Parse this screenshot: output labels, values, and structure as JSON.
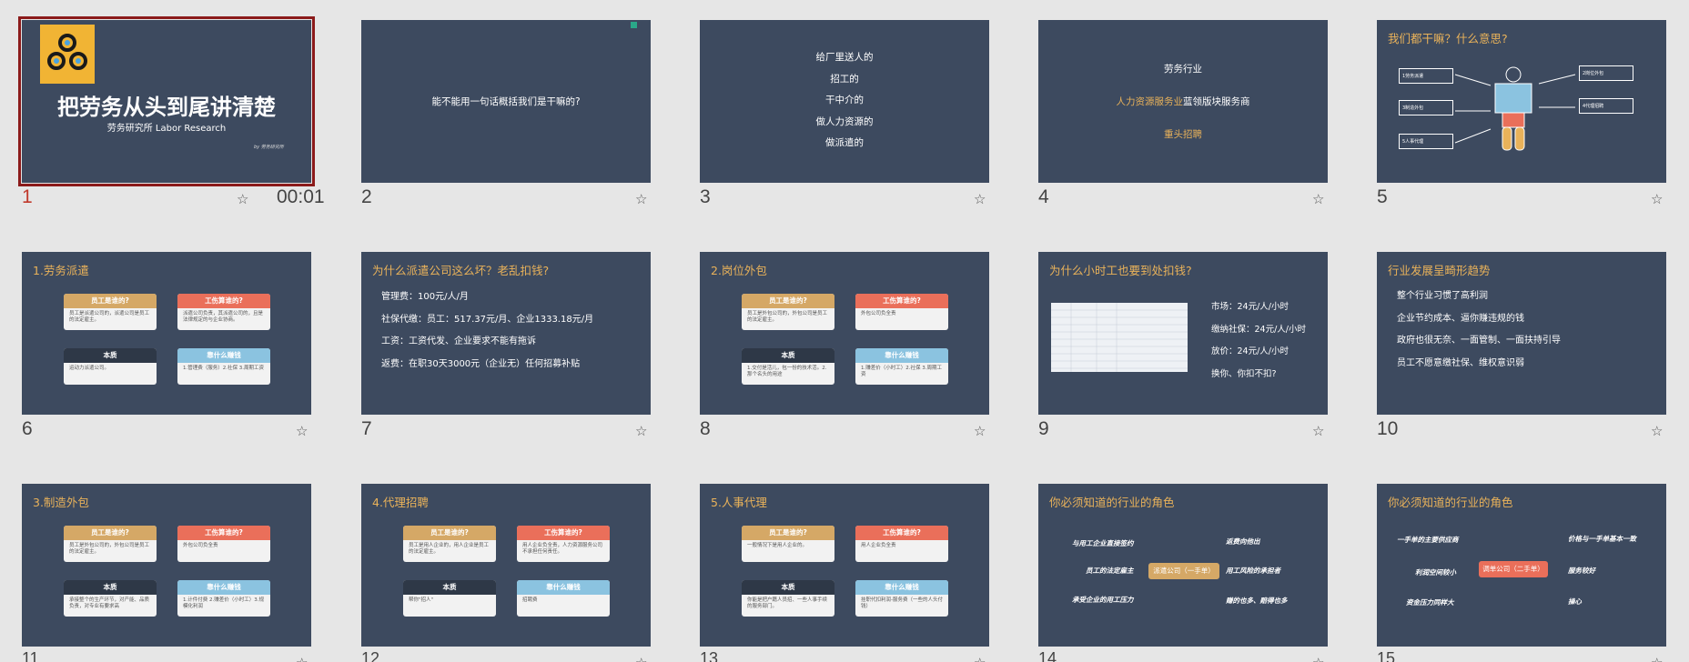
{
  "tiles": [
    {
      "num": "1",
      "duration": "00:01",
      "title": "把劳务从头到尾讲清楚",
      "subtitle": "劳务研究所 Labor Research",
      "byline": "by 劳务研究所"
    },
    {
      "num": "2",
      "text": "能不能用一句话概括我们是干嘛的?"
    },
    {
      "num": "3",
      "lines": [
        "给厂里送人的",
        "招工的",
        "干中介的",
        "做人力资源的",
        "做派遣的"
      ]
    },
    {
      "num": "4",
      "line1": "劳务行业",
      "line2_accent": "人力资源服务业",
      "line2_rest": "蓝领版块服务商",
      "line3": "重头招聘"
    },
    {
      "num": "5",
      "title": "我们都干嘛？什么意思?",
      "boxes": [
        "1劳务派遣",
        "3制造外包",
        "5人事代理",
        "2岗位外包",
        "4代理招聘"
      ]
    },
    {
      "num": "6",
      "title": "1.劳务派遣",
      "cards": [
        {
          "h": "员工是谁的?",
          "b": "员工是派遣公司的，派遣公司是员工的法定雇主。"
        },
        {
          "h": "工伤算谁的?",
          "b": "派遣公司负责，其派遣公司的，且是法律规定的与企业协商。"
        },
        {
          "h": "本质",
          "b": "运动力派遣公司。"
        },
        {
          "h": "靠什么赚钱",
          "b": "1.管理费（服务）2.社保 3.周期工资"
        }
      ]
    },
    {
      "num": "7",
      "title": "为什么派遣公司这么坏？老乱扣钱?",
      "lines": [
        "管理费：100元/人/月",
        "社保代缴：员工：517.37元/月、企业1333.18元/月",
        "工资：工资代发、企业要求不能有拖诉",
        "返费：在职30天3000元（企业无）任何招募补贴"
      ]
    },
    {
      "num": "8",
      "title": "2.岗位外包",
      "cards": [
        {
          "h": "员工是谁的?",
          "b": "员工是外包公司的，外包公司是员工的法定雇主。"
        },
        {
          "h": "工伤算谁的?",
          "b": "外包公司负全责"
        },
        {
          "h": "本质",
          "b": "1.交付是活儿，包一份的技术活。2.那个名头的用途"
        },
        {
          "h": "靠什么赚钱",
          "b": "1.赚差价（小时工）2.社保 3.周期工资"
        }
      ]
    },
    {
      "num": "9",
      "title": "为什么小时工也要到处扣钱?",
      "lines": [
        "市场：24元/人/小时",
        "缴纳社保：24元/人/小时",
        "放价：24元/人/小时",
        "换你、你扣不扣?"
      ]
    },
    {
      "num": "10",
      "title": "行业发展呈畸形趋势",
      "lines": [
        "整个行业习惯了高利润",
        "企业节约成本、逼你赚违规的钱",
        "政府也很无奈、一面管制、一面扶持引导",
        "员工不愿意缴社保、维权意识弱"
      ]
    },
    {
      "num": "11",
      "title": "3.制造外包",
      "cards": [
        {
          "h": "员工是谁的?",
          "b": "员工是外包公司的，外包公司是员工的法定雇主。"
        },
        {
          "h": "工伤算谁的?",
          "b": "外包公司负全责"
        },
        {
          "h": "本质",
          "b": "承接整个的生产环节，对产能、品质负责，对专业有要求高"
        },
        {
          "h": "靠什么赚钱",
          "b": "1.计件付费 2.赚差价（小时工）3.规模化利润"
        }
      ]
    },
    {
      "num": "12",
      "title": "4.代理招聘",
      "cards": [
        {
          "h": "员工是谁的?",
          "b": "员工是用人企业的，用人企业是员工的法定雇主。"
        },
        {
          "h": "工伤算谁的?",
          "b": "用人企业负全责，人力资源服务公司不承担任何责任。"
        },
        {
          "h": "本质",
          "b": "帮你\"招人\""
        },
        {
          "h": "靠什么赚钱",
          "b": "招聘费"
        }
      ]
    },
    {
      "num": "13",
      "title": "5.人事代理",
      "cards": [
        {
          "h": "员工是谁的?",
          "b": "一般情况下是用人企业的。"
        },
        {
          "h": "工伤算谁的?",
          "b": "用人企业负全责"
        },
        {
          "h": "本质",
          "b": "你能是把户籍人员招、一些人事手续的服务部门。"
        },
        {
          "h": "靠什么赚钱",
          "b": "挂职代扣利润-服务费（一些的人头付钱）"
        }
      ]
    },
    {
      "num": "14",
      "title": "你必须知道的行业的角色",
      "items": [
        "与用工企业直接签约",
        "员工的法定雇主",
        "承受企业的用工压力",
        "返费向他出",
        "用工风险的承担者",
        "赚的也多、赔得也多"
      ],
      "pill": "派遣公司（一手单）"
    },
    {
      "num": "15",
      "title": "你必须知道的行业的角色",
      "items": [
        "一手单的主要供应商",
        "利润空间较小",
        "资金压力同样大",
        "价格与一手单基本一致",
        "服务较好",
        "操心"
      ],
      "pill": "调单公司（二手单）"
    }
  ],
  "colors": {
    "slide_bg": "#3d4a5f",
    "accent": "#e9b25a",
    "selection": "#8b1a1a"
  }
}
